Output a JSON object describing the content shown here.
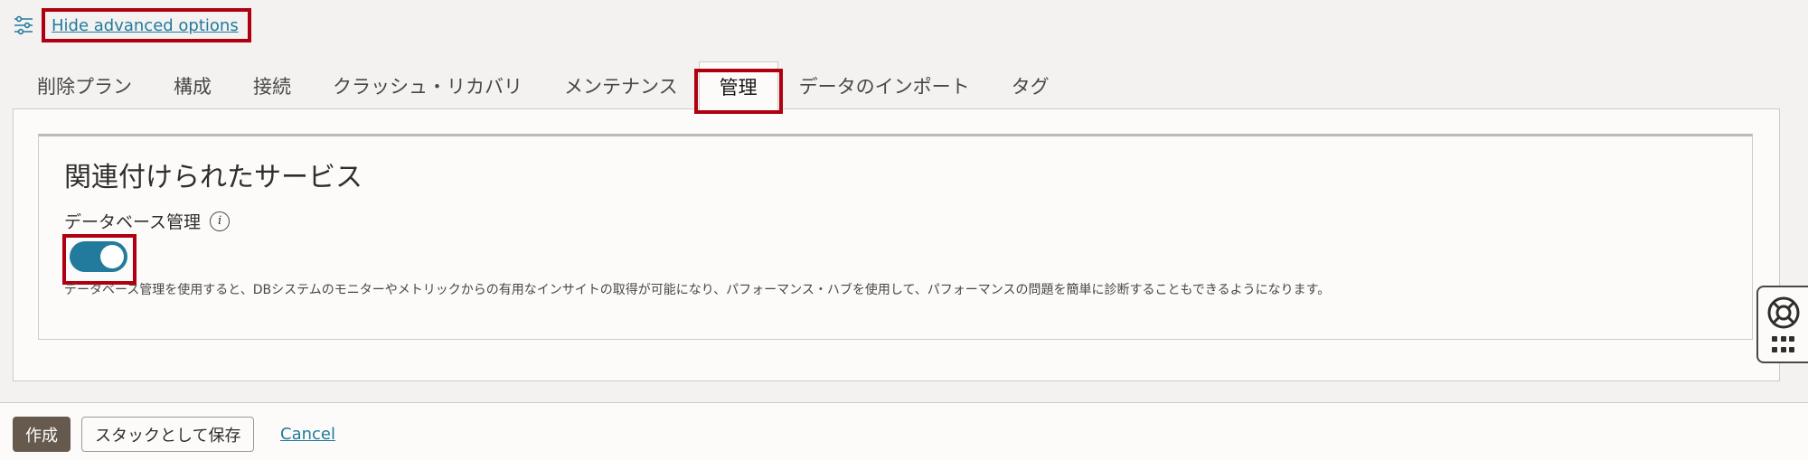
{
  "advanced": {
    "toggle_link": "Hide advanced options",
    "icon": "sliders-icon"
  },
  "tabs": [
    {
      "label": "削除プラン",
      "active": false
    },
    {
      "label": "構成",
      "active": false
    },
    {
      "label": "接続",
      "active": false
    },
    {
      "label": "クラッシュ・リカバリ",
      "active": false
    },
    {
      "label": "メンテナンス",
      "active": false
    },
    {
      "label": "管理",
      "active": true
    },
    {
      "label": "データのインポート",
      "active": false
    },
    {
      "label": "タグ",
      "active": false
    }
  ],
  "section": {
    "title": "関連付けられたサービス",
    "field_label": "データベース管理",
    "info_icon": "info-icon",
    "toggle_on": true,
    "help_text": "データベース管理を使用すると、DBシステムのモニターやメトリックからの有用なインサイトの取得が可能になり、パフォーマンス・ハブを使用して、パフォーマンスの問題を簡単に診断することもできるようになります。"
  },
  "footer": {
    "create_label": "作成",
    "save_stack_label": "スタックとして保存",
    "cancel_label": "Cancel"
  },
  "help_widget": {
    "icons": [
      "lifebuoy-icon",
      "app-grid-icon"
    ]
  },
  "colors": {
    "accent": "#227b9c",
    "highlight": "#b00010",
    "primary_button": "#665a4f",
    "background": "#f3f2f1",
    "panel": "#fcfbfa"
  }
}
